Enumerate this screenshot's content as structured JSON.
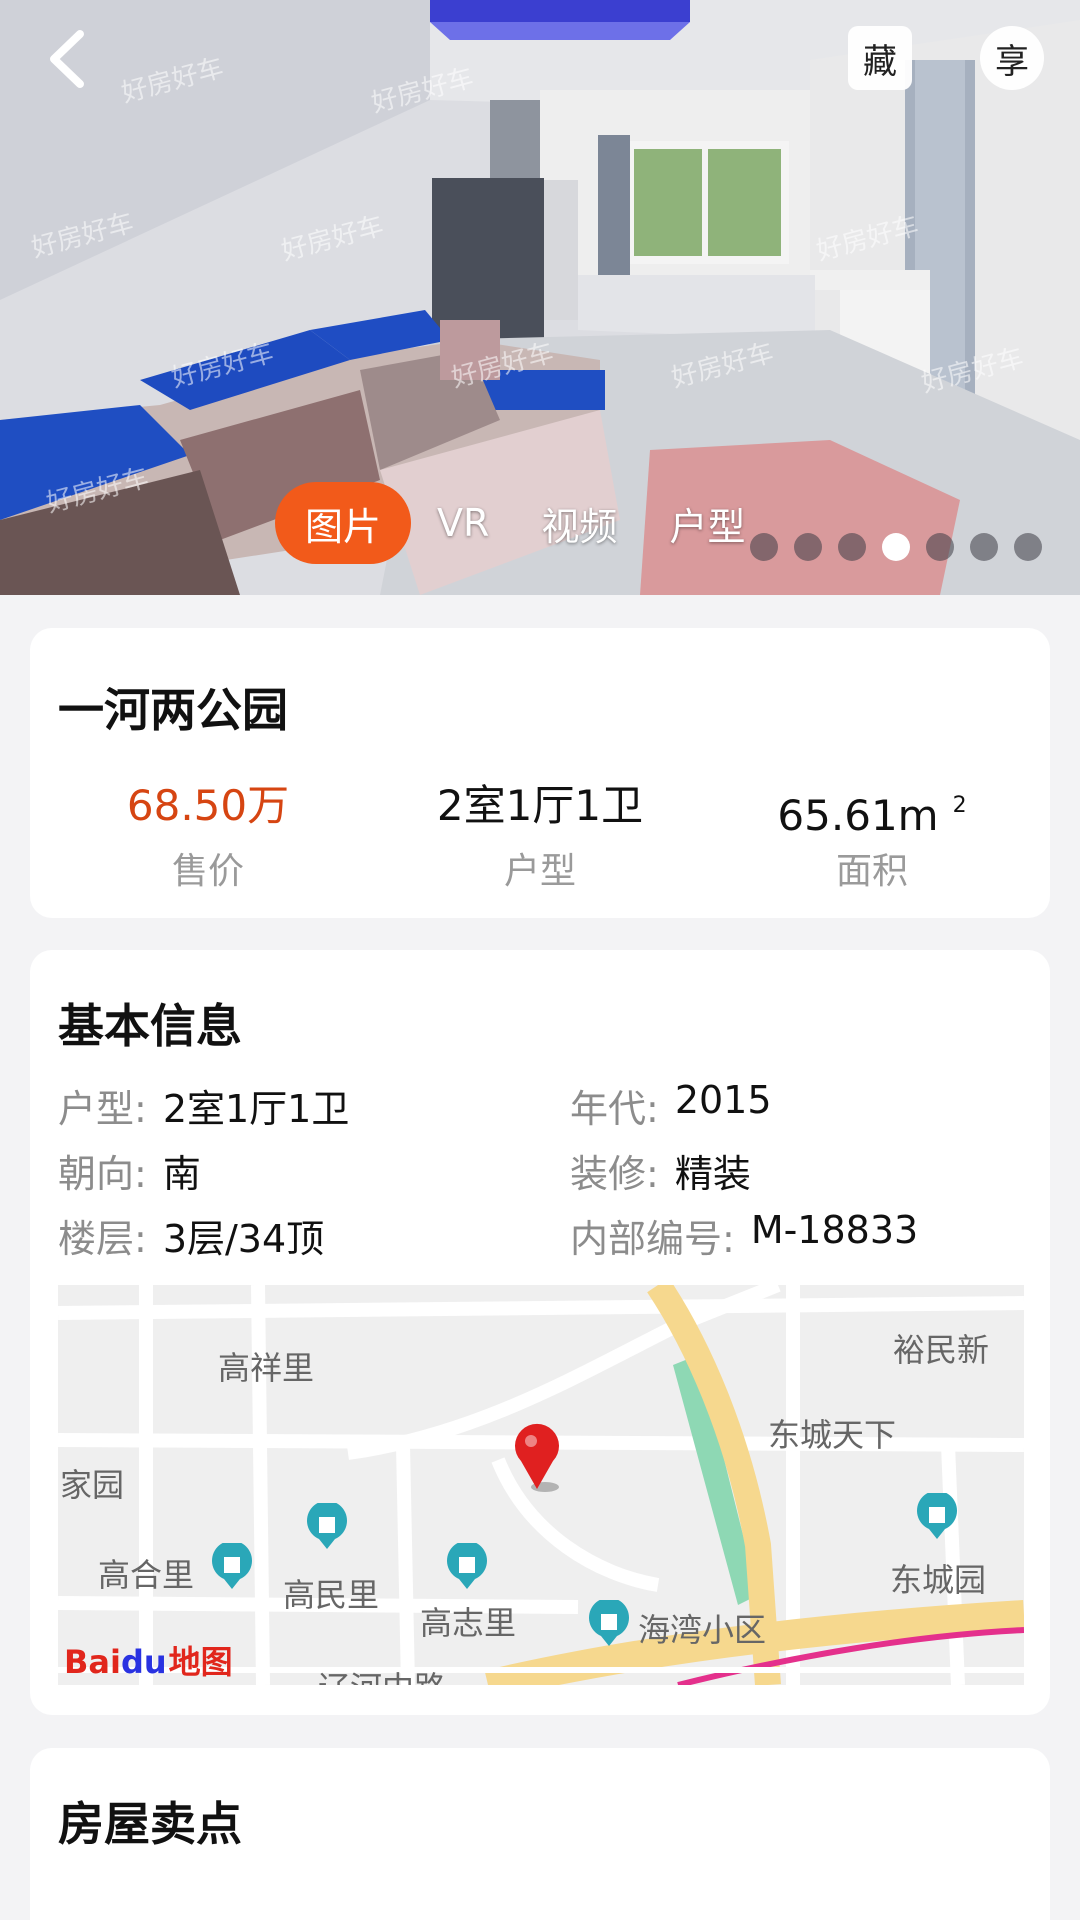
{
  "header": {
    "back_icon": "chevron-left-icon",
    "favorite_label": "藏",
    "share_label": "享"
  },
  "gallery": {
    "watermark": "好房好车",
    "tabs": [
      {
        "label": "图片",
        "active": true
      },
      {
        "label": "VR",
        "active": false
      },
      {
        "label": "视频",
        "active": false
      },
      {
        "label": "户型",
        "active": false
      }
    ],
    "page_dots": 7,
    "active_dot": 4
  },
  "summary": {
    "title": "一河两公园",
    "price_value": "68.50万",
    "price_label": "售价",
    "layout_value": "2室1厅1卫",
    "layout_label": "户型",
    "area_value": "65.61m",
    "area_unit_sup": "2",
    "area_label": "面积",
    "accent_color": "#d64512"
  },
  "basic_info": {
    "title": "基本信息",
    "rows": [
      {
        "key": "户型:",
        "value": "2室1厅1卫"
      },
      {
        "key": "年代:",
        "value": "2015"
      },
      {
        "key": "朝向:",
        "value": "南"
      },
      {
        "key": "装修:",
        "value": "精装"
      },
      {
        "key": "楼层:",
        "value": "3层/34顶"
      },
      {
        "key": "内部编号:",
        "value": "M-18833"
      }
    ]
  },
  "map": {
    "labels": [
      "高祥里",
      "裕民新",
      "东城天下",
      "家园",
      "高合里",
      "高民里",
      "高志里",
      "东城园",
      "海湾小区",
      "辽河中路"
    ],
    "logo_bai": "Bai",
    "logo_du": "du",
    "logo_map": "地图",
    "pin_color": "#e02020",
    "poi_color": "#2aa7b8"
  },
  "selling_points": {
    "title": "房屋卖点"
  },
  "tab_active_color": "#f25a1a"
}
